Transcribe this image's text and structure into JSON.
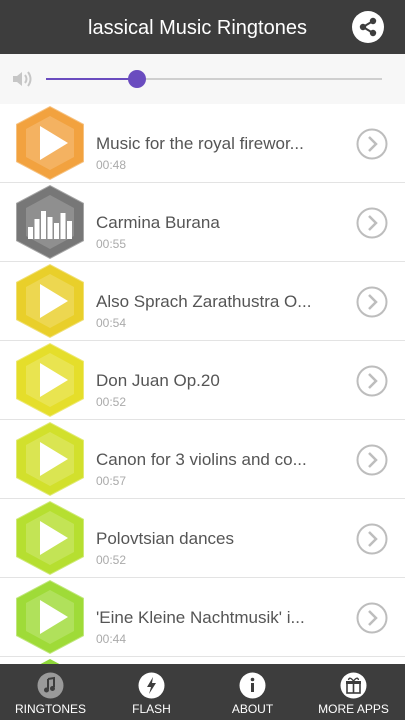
{
  "app": {
    "title": "lassical Music Ringtones",
    "share_icon": "share-icon"
  },
  "volume": {
    "level": 0.27,
    "icon": "speaker-icon",
    "accent": "#6a4cbf"
  },
  "ringtones": [
    {
      "title": "Music for the royal firewor...",
      "duration": "00:48",
      "color": "#f2a23f",
      "icon": "play-icon"
    },
    {
      "title": "Carmina Burana",
      "duration": "00:55",
      "color": "#777777",
      "icon": "equalizer-icon"
    },
    {
      "title": "Also Sprach Zarathustra O...",
      "duration": "00:54",
      "color": "#e9cf2a",
      "icon": "play-icon"
    },
    {
      "title": "Don Juan Op.20",
      "duration": "00:52",
      "color": "#e5de2a",
      "icon": "play-icon"
    },
    {
      "title": "Canon for 3 violins and co...",
      "duration": "00:57",
      "color": "#d2e02c",
      "icon": "play-icon"
    },
    {
      "title": "Polovtsian dances",
      "duration": "00:52",
      "color": "#b6df30",
      "icon": "play-icon"
    },
    {
      "title": "'Eine Kleine Nachtmusik' i...",
      "duration": "00:44",
      "color": "#9fdb38",
      "icon": "play-icon"
    }
  ],
  "bottom_nav": [
    {
      "label": "RINGTONES",
      "icon": "music-note-icon"
    },
    {
      "label": "FLASH",
      "icon": "flash-icon"
    },
    {
      "label": "ABOUT",
      "icon": "info-icon"
    },
    {
      "label": "MORE APPS",
      "icon": "gift-icon"
    }
  ]
}
